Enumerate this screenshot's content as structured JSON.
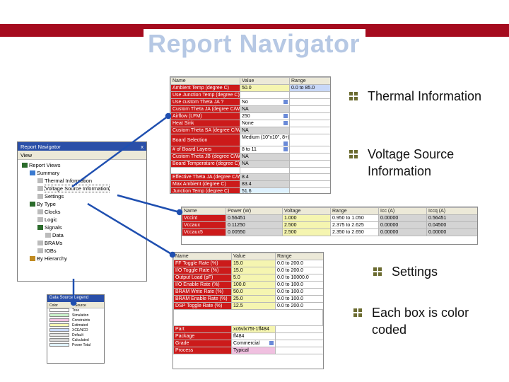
{
  "slide": {
    "title": "Report Navigator",
    "bullets": [
      "Thermal Information",
      "Voltage Source Information",
      "Settings",
      "Each box is color coded"
    ]
  },
  "thermal_table": {
    "headers": [
      "Name",
      "Value",
      "Range"
    ],
    "rows": [
      [
        "Ambient Temp (degree C)",
        "50.0",
        "0.0 to 85.0"
      ],
      [
        "Use Junction Temp (degree C)",
        "",
        ""
      ],
      [
        "Use custom Theta JA ?",
        "No",
        ""
      ],
      [
        "Custom Theta JA (degree C/W)",
        "NA",
        ""
      ],
      [
        "Airflow (LFM)",
        "250",
        ""
      ],
      [
        "Heat Sink",
        "None",
        ""
      ],
      [
        "Custom Theta SA (degree C/W)",
        "NA",
        ""
      ],
      [
        "Board Selection",
        "Medium (10\"x10\", 8+)",
        ""
      ],
      [
        "# of Board Layers",
        "8 to 11",
        ""
      ],
      [
        "Custom Theta JB (degree C/W)",
        "NA",
        ""
      ],
      [
        "Board Temperature (degree C)",
        "NA",
        ""
      ],
      [
        "",
        "",
        ""
      ],
      [
        "Effective Theta JA (degree C/W)",
        "8.4",
        ""
      ],
      [
        "Max Ambient (degree C)",
        "83.4",
        ""
      ],
      [
        "Junction Temp (degree C)",
        "51.6",
        ""
      ]
    ]
  },
  "voltage_table": {
    "headers": [
      "Name",
      "Power (W)",
      "Voltage",
      "Range",
      "Icc (A)",
      "Iccq (A)"
    ],
    "rows": [
      [
        "Vccint",
        "0.56451",
        "1.000",
        "0.950 to 1.050",
        "0.00000",
        "0.56451"
      ],
      [
        "Vccaux",
        "0.11250",
        "2.500",
        "2.375 to 2.625",
        "0.00000",
        "0.04500"
      ],
      [
        "Vccaux5",
        "0.00550",
        "2.500",
        "2.350 to 2.650",
        "0.00000",
        "0.00000"
      ]
    ]
  },
  "settings_table": {
    "headers": [
      "Name",
      "Value",
      "Range"
    ],
    "rows": [
      [
        "FF Toggle Rate (%)",
        "15.0",
        "0.0 to 200.0"
      ],
      [
        "I/O Toggle Rate (%)",
        "15.0",
        "0.0 to 200.0"
      ],
      [
        "Output Load (pF)",
        "5.0",
        "0.0 to 10000.0"
      ],
      [
        "I/O Enable Rate (%)",
        "100.0",
        "0.0 to 100.0"
      ],
      [
        "BRAM Write Rate (%)",
        "50.0",
        "0.0 to 100.0"
      ],
      [
        "BRAM Enable Rate (%)",
        "25.0",
        "0.0 to 100.0"
      ],
      [
        "DSP Toggle Rate (%)",
        "12.5",
        "0.0 to 200.0"
      ]
    ],
    "device_rows": [
      [
        "Part",
        "xc6vlx75t-1ff484"
      ],
      [
        "Package",
        "ff484"
      ],
      [
        "Grade",
        "Commercial"
      ],
      [
        "Process",
        "Typical"
      ]
    ]
  },
  "navigator": {
    "title": "Report Navigator",
    "close": "x",
    "view_menu": "View",
    "tree": [
      {
        "label": "Report Views",
        "depth": 0
      },
      {
        "label": "Summary",
        "depth": 1
      },
      {
        "label": "Thermal Information",
        "depth": 2
      },
      {
        "label": "Voltage Source Information",
        "depth": 2
      },
      {
        "label": "Settings",
        "depth": 2
      },
      {
        "label": "By Type",
        "depth": 1
      },
      {
        "label": "Clocks",
        "depth": 2
      },
      {
        "label": "Logic",
        "depth": 2
      },
      {
        "label": "Signals",
        "depth": 2
      },
      {
        "label": "Data",
        "depth": 3
      },
      {
        "label": "BRAMs",
        "depth": 2
      },
      {
        "label": "IOBs",
        "depth": 2
      },
      {
        "label": "By Hierarchy",
        "depth": 1
      }
    ]
  },
  "legend": {
    "title": "Data Source Legend",
    "headers": [
      "Color",
      "Source"
    ],
    "items": [
      {
        "label": "Tree",
        "color": "#ffffff"
      },
      {
        "label": "Simulation",
        "color": "#c8f0c8"
      },
      {
        "label": "Constraints",
        "color": "#f0c0e0"
      },
      {
        "label": "Estimated",
        "color": "#f5f5b0"
      },
      {
        "label": "XCE/NCD",
        "color": "#c8d8f8"
      },
      {
        "label": "Default",
        "color": "#e0e0e0"
      },
      {
        "label": "Calculated",
        "color": "#d4d4d4"
      },
      {
        "label": "Power Total",
        "color": "#dff2ff"
      }
    ]
  },
  "colors": {
    "brand_band": "#a50b1e",
    "title": "#b6c8e4",
    "selection_blue": "#2a4fa8"
  }
}
